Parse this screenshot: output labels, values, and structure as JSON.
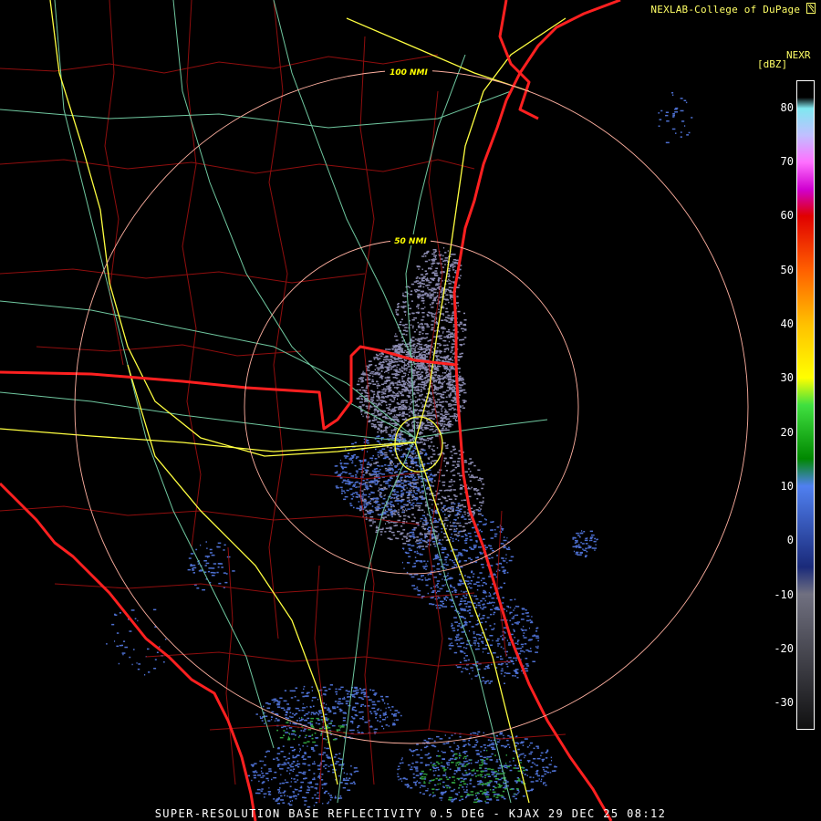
{
  "credit": "NEXLAB-College of DuPage",
  "credit_icon": "lightning-bolt-icon",
  "product_tag": "NEXR",
  "units": "[dBZ]",
  "scale": {
    "ticks": [
      "80",
      "70",
      "60",
      "50",
      "40",
      "30",
      "20",
      "10",
      "0",
      "-10",
      "-20",
      "-30"
    ],
    "colors": [
      {
        "dbz": 80,
        "color": "#80e8f0"
      },
      {
        "dbz": 75,
        "color": "#c0c0ff"
      },
      {
        "dbz": 70,
        "color": "#ff70ff"
      },
      {
        "dbz": 65,
        "color": "#d000d0"
      },
      {
        "dbz": 60,
        "color": "#e00000"
      },
      {
        "dbz": 50,
        "color": "#ff6000"
      },
      {
        "dbz": 40,
        "color": "#ffc000"
      },
      {
        "dbz": 30,
        "color": "#ffff00"
      },
      {
        "dbz": 25,
        "color": "#40e040"
      },
      {
        "dbz": 15,
        "color": "#008800"
      },
      {
        "dbz": 10,
        "color": "#5080f0"
      },
      {
        "dbz": -5,
        "color": "#1a2a7a"
      },
      {
        "dbz": -10,
        "color": "#707080"
      },
      {
        "dbz": -35,
        "color": "#101010"
      }
    ]
  },
  "range_rings": [
    {
      "label": "50 NMI"
    },
    {
      "label": "100 NMI"
    }
  ],
  "footer": "SUPER-RESOLUTION BASE REFLECTIVITY 0.5 DEG - KJAX 29 DEC 25 08:12",
  "colors": {
    "state_border": "#ff2020",
    "county_border": "#b01010",
    "highway": "#ffff40",
    "road": "#7fd0a0",
    "ring": "#ffb0a0",
    "echo_light": "#8a8ab0",
    "echo_blue": "#4d6fd0",
    "echo_green": "#30a040"
  }
}
